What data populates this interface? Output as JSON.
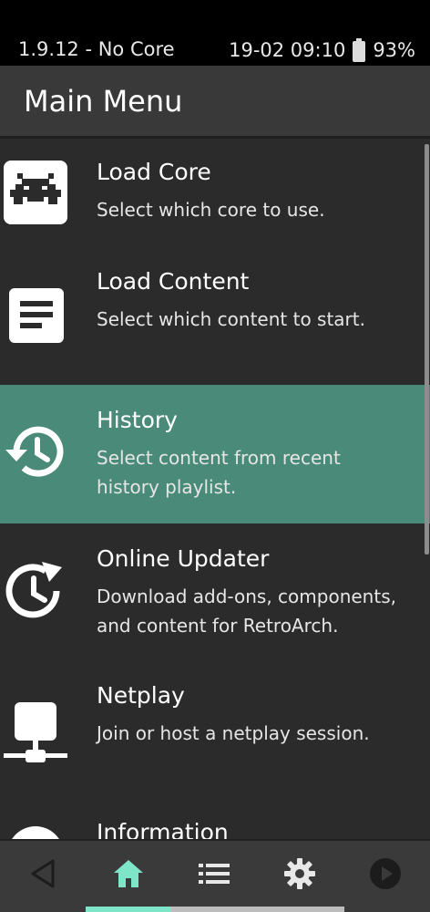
{
  "status_bar": {
    "left_text": "1.9.12 - No Core",
    "clock": "19-02 09:10",
    "battery": "93%"
  },
  "header": {
    "title": "Main Menu"
  },
  "menu": {
    "items": [
      {
        "title": "Load Core",
        "description": "Select which core to use.",
        "icon": "retroarch-invader-icon",
        "selected": false
      },
      {
        "title": "Load Content",
        "description": "Select which content to start.",
        "icon": "document-icon",
        "selected": false
      },
      {
        "title": "History",
        "description": "Select content from recent history playlist.",
        "icon": "history-icon",
        "selected": true
      },
      {
        "title": "Online Updater",
        "description": "Download add-ons, components, and content for RetroArch.",
        "icon": "update-clock-icon",
        "selected": false
      },
      {
        "title": "Netplay",
        "description": "Join or host a netplay session.",
        "icon": "network-icon",
        "selected": false
      },
      {
        "title": "Information",
        "description": "",
        "icon": "info-icon",
        "selected": false
      }
    ]
  },
  "bottom_nav": {
    "items": [
      {
        "icon": "back-triangle-icon",
        "active": false
      },
      {
        "icon": "home-icon",
        "active": true
      },
      {
        "icon": "list-icon",
        "active": false
      },
      {
        "icon": "gear-icon",
        "active": false
      },
      {
        "icon": "play-circle-icon",
        "active": false
      }
    ]
  },
  "colors": {
    "background": "#2b2b2b",
    "header": "#393939",
    "selected_row": "#4a8a78",
    "accent": "#7ee5c8",
    "bottom_bar": "#3a3a3a"
  }
}
